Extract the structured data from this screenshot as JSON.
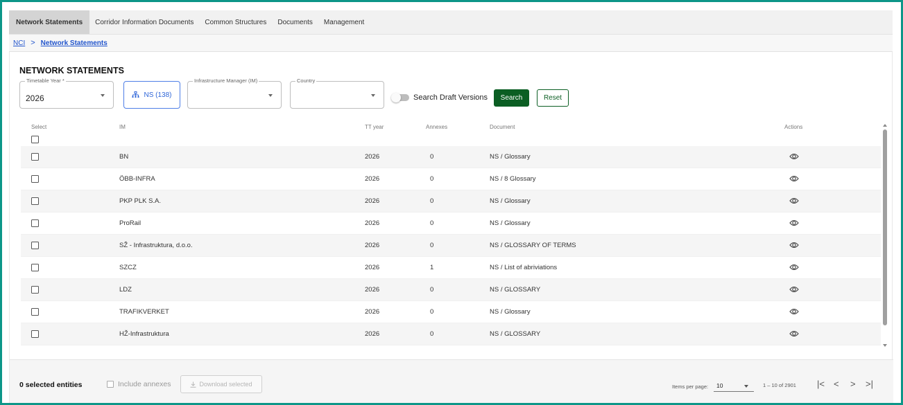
{
  "nav": {
    "tabs": [
      {
        "label": "Network Statements"
      },
      {
        "label": "Corridor Information Documents"
      },
      {
        "label": "Common Structures"
      },
      {
        "label": "Documents"
      },
      {
        "label": "Management"
      }
    ]
  },
  "breadcrumb": {
    "root": "NCI",
    "separator": ">",
    "current": "Network Statements"
  },
  "page": {
    "title": "NETWORK STATEMENTS"
  },
  "filters": {
    "timetable_year": {
      "label": "Timetable Year *",
      "value": "2026"
    },
    "ns_button": {
      "label": "NS (138)",
      "icon": "hierarchy-icon"
    },
    "infrastructure_manager": {
      "label": "Infrastructure Manager (IM)",
      "value": ""
    },
    "country": {
      "label": "Country",
      "value": ""
    },
    "draft_toggle": {
      "label": "Search Draft Versions",
      "on": false
    },
    "search_label": "Search",
    "reset_label": "Reset",
    "accent_color": "#0b5e23"
  },
  "table": {
    "headers": {
      "select": "Select",
      "im": "IM",
      "tt_year": "TT year",
      "annexes": "Annexes",
      "document": "Document",
      "actions": "Actions"
    },
    "rows": [
      {
        "im": "BN",
        "tt_year": "2026",
        "annexes": "0",
        "document": "NS / Glossary"
      },
      {
        "im": "ÖBB-INFRA",
        "tt_year": "2026",
        "annexes": "0",
        "document": "NS / 8 Glossary"
      },
      {
        "im": "PKP PLK S.A.",
        "tt_year": "2026",
        "annexes": "0",
        "document": "NS / Glossary"
      },
      {
        "im": "ProRail",
        "tt_year": "2026",
        "annexes": "0",
        "document": "NS / Glossary"
      },
      {
        "im": "SŽ - Infrastruktura, d.o.o.",
        "tt_year": "2026",
        "annexes": "0",
        "document": "NS / GLOSSARY OF TERMS"
      },
      {
        "im": "SZCZ",
        "tt_year": "2026",
        "annexes": "1",
        "document": "NS / List of abriviations"
      },
      {
        "im": "LDZ",
        "tt_year": "2026",
        "annexes": "0",
        "document": "NS / GLOSSARY"
      },
      {
        "im": "TRAFIKVERKET",
        "tt_year": "2026",
        "annexes": "0",
        "document": "NS / Glossary"
      },
      {
        "im": "HŽ-Infrastruktura",
        "tt_year": "2026",
        "annexes": "0",
        "document": "NS / GLOSSARY"
      }
    ]
  },
  "footer": {
    "selected_count": "0 selected entities",
    "include_annexes": "Include annexes",
    "download_selected": "Download selected",
    "items_per_page_label": "Items per page:",
    "items_per_page_value": "10",
    "range": "1 – 10 of 2901",
    "first_page": "|<",
    "prev_page": "<",
    "next_page": ">",
    "last_page": ">|"
  },
  "frame_color": "#0c9688"
}
